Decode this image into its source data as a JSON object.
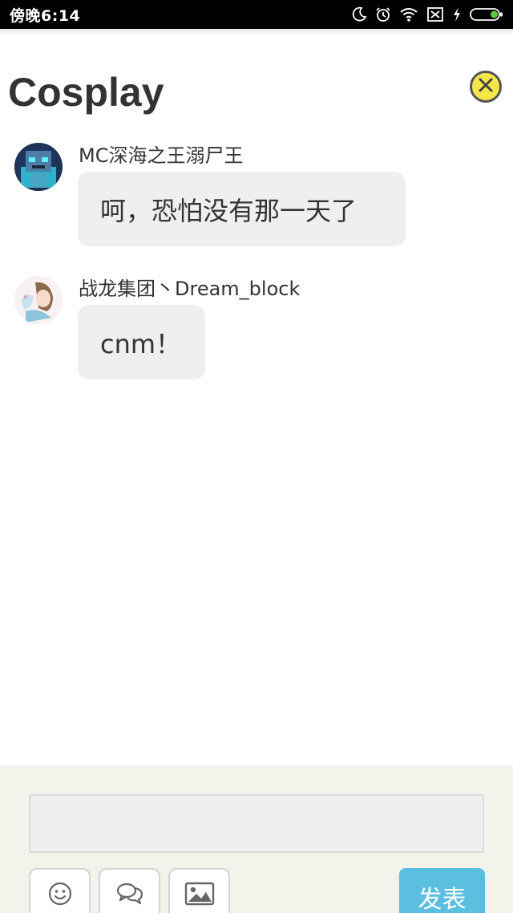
{
  "status_bar": {
    "time": "傍晚6:14",
    "icons": [
      "moon-icon",
      "alarm-icon",
      "wifi-icon",
      "sim-off-icon",
      "charging-icon",
      "battery-icon"
    ],
    "battery_color": "#5ecb3a"
  },
  "header": {
    "title": "Cosplay",
    "close_icon": "close-circle-icon",
    "close_color": "#f5e64a"
  },
  "messages": [
    {
      "sender": "MC深海之王溺尸王",
      "text": "呵，恐怕没有那一天了",
      "avatar": "avatar-drowned-icon"
    },
    {
      "sender": "战龙集团丶Dream_block",
      "text": "cnm！",
      "avatar": "avatar-anime-icon"
    }
  ],
  "composer": {
    "input_value": "",
    "tools": [
      "emoji-icon",
      "chat-bubbles-icon",
      "image-icon"
    ],
    "submit_label": "发表",
    "submit_color": "#5bbfe0"
  }
}
